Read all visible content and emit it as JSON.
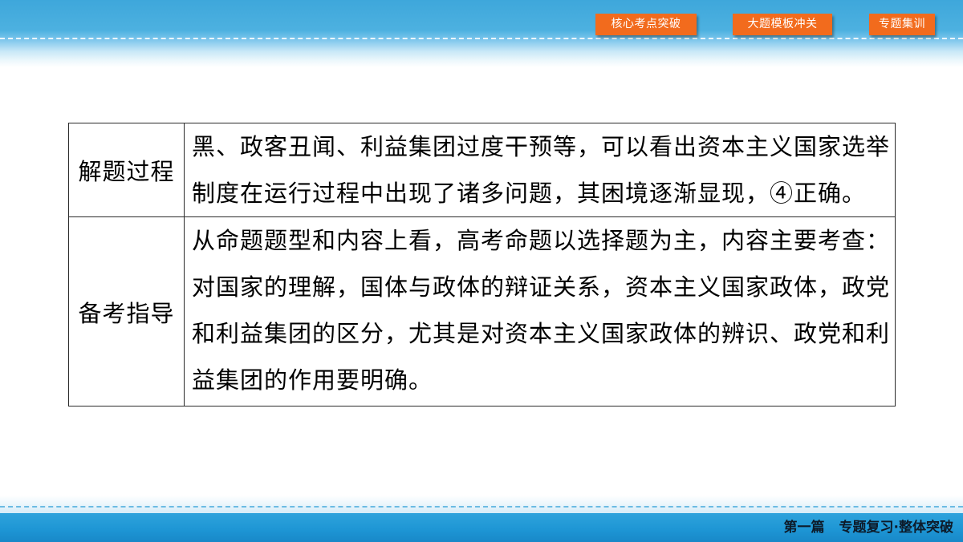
{
  "nav": {
    "buttons": [
      "核心考点突破",
      "大题模板冲关",
      "专题集训"
    ]
  },
  "table": {
    "rows": [
      {
        "label": "解题过程",
        "lines": [
          "黑、政客丑闻、利益集团过度干预等，可以看出资本主义国家选举",
          "制度在运行过程中出现了诸多问题，其困境逐渐显现，④正确。"
        ]
      },
      {
        "label": "备考指导",
        "lines": [
          "从命题题型和内容上看，高考命题以选择题为主，内容主要考查：",
          "对国家的理解，国体与政体的辩证关系，资本主义国家政体，政党",
          "和利益集团的区分，尤其是对资本主义国家政体的辨识、政党和利",
          "益集团的作用要明确。"
        ]
      }
    ]
  },
  "footer": {
    "section": "第一篇",
    "title": "专题复习·整体突破"
  },
  "colors": {
    "nav_button": "#f26b1d",
    "header_blue": "#4db1e0",
    "footer_blue": "#1d95d4",
    "table_border": "#2b2b2b",
    "footer_text": "#0d1b2a"
  }
}
